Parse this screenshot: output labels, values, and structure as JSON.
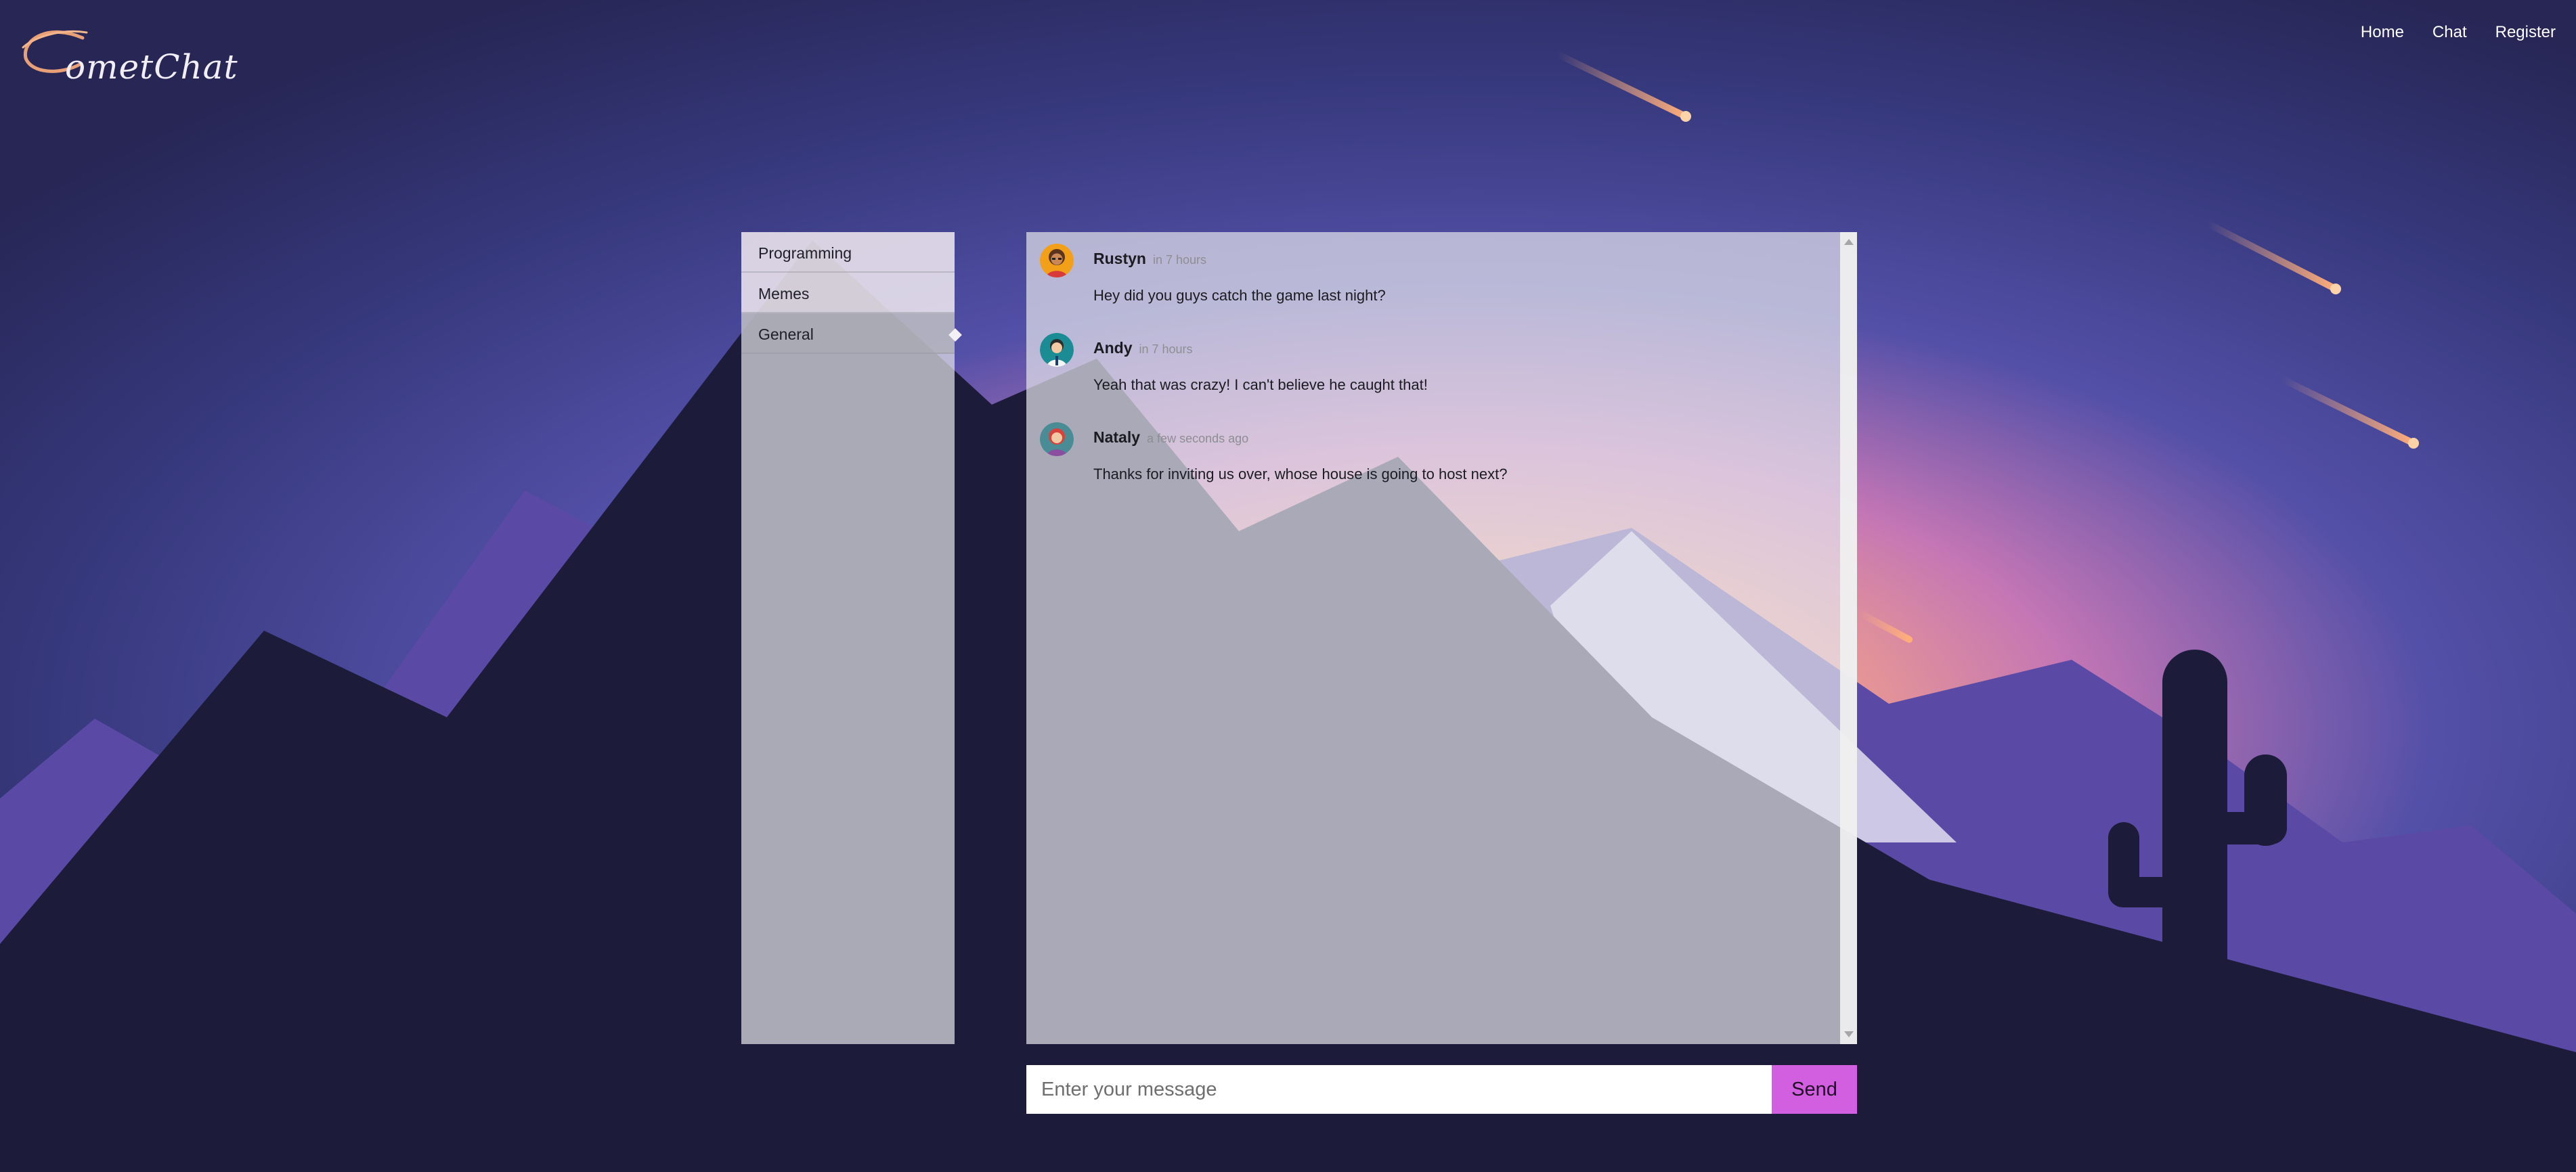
{
  "app": {
    "logo_text": "ometChat"
  },
  "nav": {
    "home": "Home",
    "chat": "Chat",
    "register": "Register"
  },
  "channels": [
    {
      "label": "Programming",
      "active": false
    },
    {
      "label": "Memes",
      "active": false
    },
    {
      "label": "General",
      "active": true
    }
  ],
  "messages": [
    {
      "name": "Rustyn",
      "time": "in 7 hours",
      "text": "Hey did you guys catch the game last night?",
      "avatar": "man-avatar-icon"
    },
    {
      "name": "Andy",
      "time": "in 7 hours",
      "text": "Yeah that was crazy! I can't believe he caught that!",
      "avatar": "doctor-avatar-icon"
    },
    {
      "name": "Nataly",
      "time": "a few seconds ago",
      "text": "Thanks for inviting us over, whose house is going to host next?",
      "avatar": "woman-avatar-icon"
    }
  ],
  "composer": {
    "placeholder": "Enter your message",
    "value": "",
    "send_label": "Send"
  },
  "colors": {
    "send_button": "#d25ee0",
    "sky_top": "#3e3f91",
    "sky_glow": "#f4a786",
    "mountain_dark": "#1c1b3a",
    "mountain_purple": "#5a4aa6"
  }
}
